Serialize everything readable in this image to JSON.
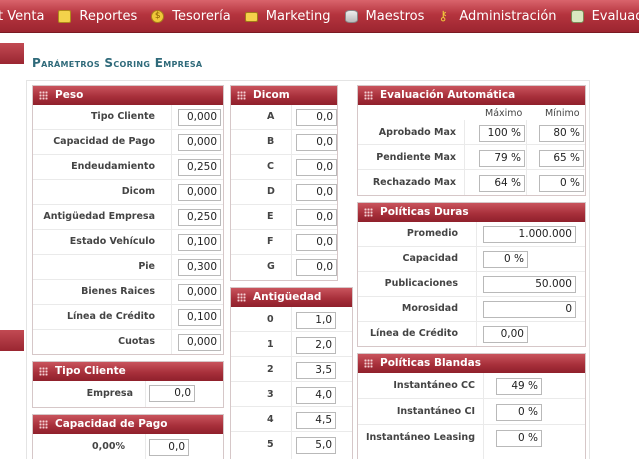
{
  "menu": [
    {
      "label": "t Venta",
      "icon": "none"
    },
    {
      "label": "Reportes",
      "icon": "document-icon"
    },
    {
      "label": "Tesorería",
      "icon": "coin-icon"
    },
    {
      "label": "Marketing",
      "icon": "monitor-icon"
    },
    {
      "label": "Maestros",
      "icon": "database-icon"
    },
    {
      "label": "Administración",
      "icon": "key-icon"
    },
    {
      "label": "Evaluad",
      "icon": "evaluation-icon"
    }
  ],
  "page_title": "Parámetros Scoring Empresa",
  "peso": {
    "title": "Peso",
    "rows": [
      {
        "label": "Tipo Cliente",
        "value": "0,000"
      },
      {
        "label": "Capacidad de Pago",
        "value": "0,000"
      },
      {
        "label": "Endeudamiento",
        "value": "0,250"
      },
      {
        "label": "Dicom",
        "value": "0,000"
      },
      {
        "label": "Antigüedad Empresa",
        "value": "0,250"
      },
      {
        "label": "Estado Vehículo",
        "value": "0,100"
      },
      {
        "label": "Pie",
        "value": "0,300"
      },
      {
        "label": "Bienes Raices",
        "value": "0,000"
      },
      {
        "label": "Línea de Crédito",
        "value": "0,100"
      },
      {
        "label": "Cuotas",
        "value": "0,000"
      }
    ]
  },
  "tipo_cliente": {
    "title": "Tipo Cliente",
    "rows": [
      {
        "label": "Empresa",
        "value": "0,0"
      }
    ]
  },
  "capacidad_pago": {
    "title": "Capacidad de Pago",
    "rows": [
      {
        "label": "0,00%",
        "value": "0,0"
      }
    ]
  },
  "dicom": {
    "title": "Dicom",
    "rows": [
      {
        "label": "A",
        "value": "0,0"
      },
      {
        "label": "B",
        "value": "0,0"
      },
      {
        "label": "C",
        "value": "0,0"
      },
      {
        "label": "D",
        "value": "0,0"
      },
      {
        "label": "E",
        "value": "0,0"
      },
      {
        "label": "F",
        "value": "0,0"
      },
      {
        "label": "G",
        "value": "0,0"
      }
    ]
  },
  "antiguedad": {
    "title": "Antigüedad",
    "rows": [
      {
        "label": "0",
        "value": "1,0"
      },
      {
        "label": "1",
        "value": "2,0"
      },
      {
        "label": "2",
        "value": "3,5"
      },
      {
        "label": "3",
        "value": "4,0"
      },
      {
        "label": "4",
        "value": "4,5"
      },
      {
        "label": "5",
        "value": "5,0"
      }
    ]
  },
  "evaluacion": {
    "title": "Evaluación Automática",
    "col_max": "Máximo",
    "col_min": "Mínimo",
    "rows": [
      {
        "label": "Aprobado Max",
        "max": "100 %",
        "min": "80 %"
      },
      {
        "label": "Pendiente Max",
        "max": "79 %",
        "min": "65 %"
      },
      {
        "label": "Rechazado Max",
        "max": "64 %",
        "min": "0 %"
      }
    ]
  },
  "duras": {
    "title": "Políticas Duras",
    "rows": [
      {
        "label": "Promedio",
        "value": "1.000.000"
      },
      {
        "label": "Capacidad",
        "value": "0 %"
      },
      {
        "label": "Publicaciones",
        "value": "50.000"
      },
      {
        "label": "Morosidad",
        "value": "0"
      },
      {
        "label": "Línea de Crédito",
        "value": "0,00"
      }
    ]
  },
  "blandas": {
    "title": "Políticas Blandas",
    "rows": [
      {
        "label": "Instantáneo CC",
        "value": "49 %"
      },
      {
        "label": "Instantáneo CI",
        "value": "0 %"
      },
      {
        "label": "Instantáneo Leasing",
        "value": "0 %"
      }
    ]
  }
}
